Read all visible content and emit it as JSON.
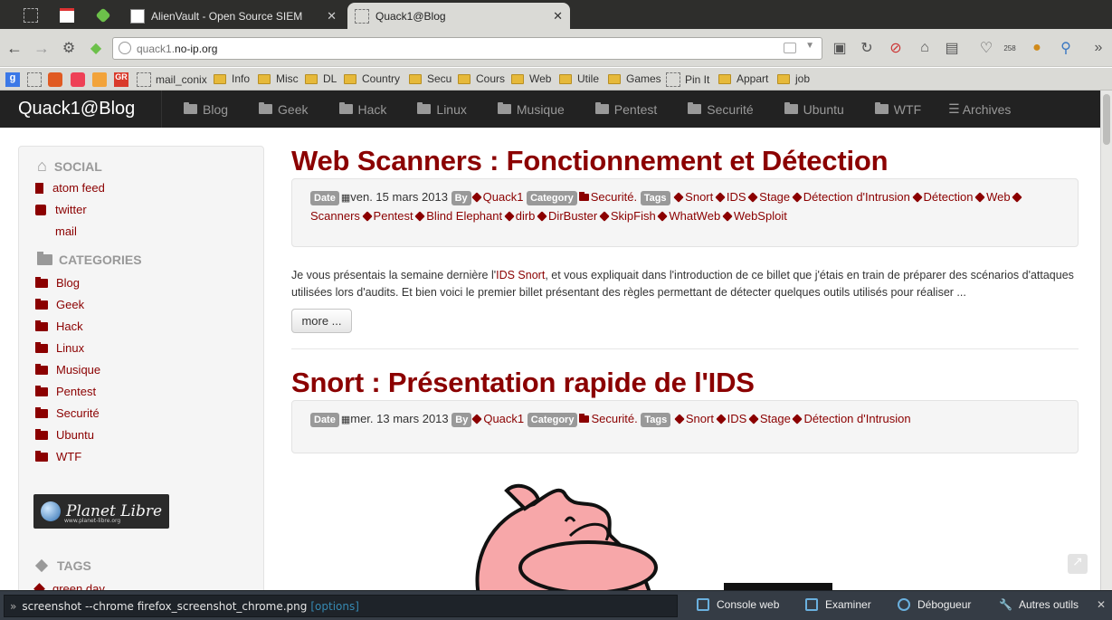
{
  "browser": {
    "tabs": [
      {
        "title": "AlienVault - Open Source SIEM"
      },
      {
        "title": "Quack1@Blog"
      }
    ],
    "url_host_prefix": "quack1.",
    "url_host_domain": "no-ip.org",
    "bookmarks": [
      "mail_conix",
      "Info",
      "Misc",
      "DL",
      "Country",
      "Secu",
      "Cours",
      "Web",
      "Utile",
      "Pin It",
      "Games",
      "Appart",
      "job"
    ],
    "badge": "258"
  },
  "site": {
    "brand": "Quack1@Blog",
    "nav": [
      "Blog",
      "Geek",
      "Hack",
      "Linux",
      "Musique",
      "Pentest",
      "Securité",
      "Ubuntu",
      "WTF"
    ],
    "archives": "Archives"
  },
  "sidebar": {
    "social_title": "SOCIAL",
    "social": [
      "atom feed",
      "twitter",
      "mail"
    ],
    "categories_title": "CATEGORIES",
    "categories": [
      "Blog",
      "Geek",
      "Hack",
      "Linux",
      "Musique",
      "Pentest",
      "Securité",
      "Ubuntu",
      "WTF"
    ],
    "planet_libre": "Planet Libre",
    "planet_url": "www.planet-libre.org",
    "tags_title": "TAGS",
    "first_tag": "green day"
  },
  "posts": [
    {
      "title": "Web Scanners : Fonctionnement et Détection",
      "date": "ven. 15 mars 2013",
      "author": "Quack1",
      "category": "Securité.",
      "tags": [
        "Snort",
        "IDS",
        "Stage",
        "Détection d'Intrusion",
        "Détection",
        "Web",
        "Scanners",
        "Pentest",
        "Blind Elephant",
        "dirb",
        "DirBuster",
        "SkipFish",
        "WhatWeb",
        "WebSploit"
      ],
      "excerpt_a": "Je vous présentais la semaine dernière l'",
      "excerpt_link": "IDS Snort",
      "excerpt_b": ", et vous expliquait dans l'introduction de ce billet que j'étais en train de préparer des scénarios d'attaques utilisées lors d'audits. Et bien voici le premier billet présentant des règles permettant de détecter quelques outils utilisés pour réaliser ...",
      "more": "more ..."
    },
    {
      "title": "Snort : Présentation rapide de l'IDS",
      "date": "mer. 13 mars 2013",
      "author": "Quack1",
      "category": "Securité.",
      "tags": [
        "Snort",
        "IDS",
        "Stage",
        "Détection d'Intrusion"
      ]
    }
  ],
  "labels": {
    "date": "Date",
    "by": "By",
    "category": "Category",
    "tags": "Tags"
  },
  "devtools": {
    "command": "screenshot --chrome firefox_screenshot_chrome.png",
    "options": "[options]",
    "buttons": [
      "Console web",
      "Examiner",
      "Débogueur",
      "Autres outils"
    ]
  }
}
